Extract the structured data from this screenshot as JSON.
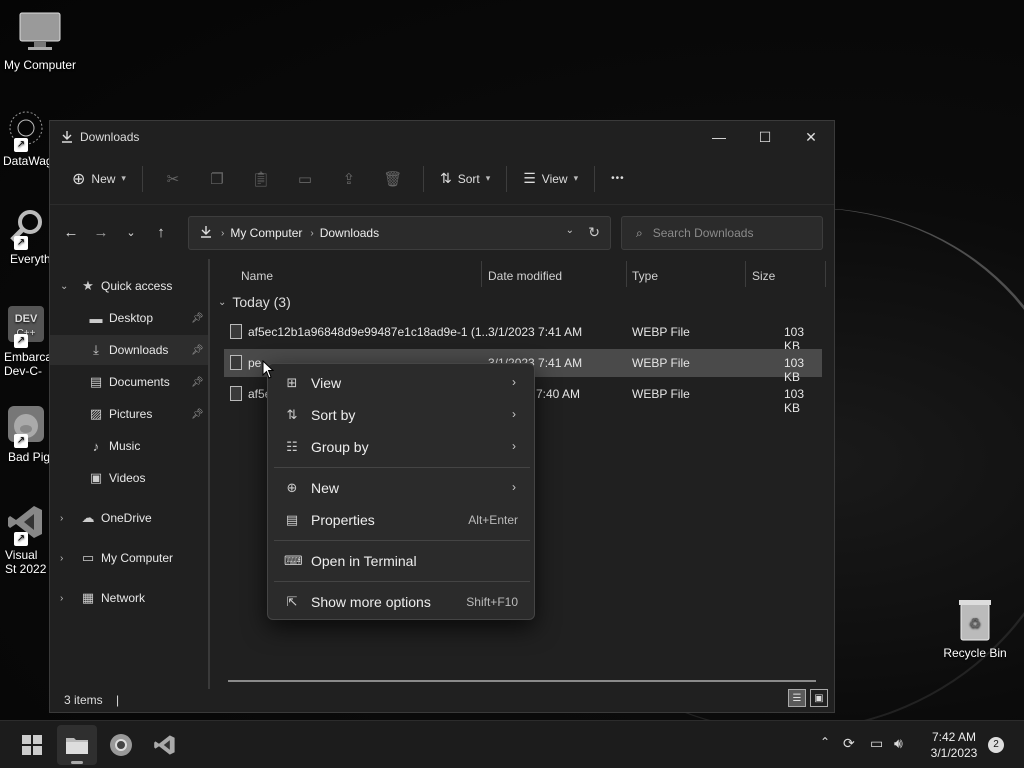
{
  "desktop": {
    "icons": [
      {
        "label": "My Computer"
      },
      {
        "label": "DataWag"
      },
      {
        "label": "Everyth"
      },
      {
        "label": "Embarca Dev-C-"
      },
      {
        "label": "Bad Pig"
      },
      {
        "label": "Visual St 2022"
      },
      {
        "label": "Recycle Bin"
      }
    ]
  },
  "window": {
    "title": "Downloads",
    "controls": {
      "minimize": "—",
      "maximize": "☐",
      "close": "✕"
    }
  },
  "toolbar": {
    "new_label": "New",
    "sort_label": "Sort",
    "view_label": "View",
    "more_label": "•••"
  },
  "address": {
    "crumbs": [
      "My Computer",
      "Downloads"
    ]
  },
  "search": {
    "placeholder": "Search Downloads"
  },
  "sidebar": {
    "items": [
      {
        "label": "Quick access"
      },
      {
        "label": "Desktop"
      },
      {
        "label": "Downloads"
      },
      {
        "label": "Documents"
      },
      {
        "label": "Pictures"
      },
      {
        "label": "Music"
      },
      {
        "label": "Videos"
      },
      {
        "label": "OneDrive"
      },
      {
        "label": "My Computer"
      },
      {
        "label": "Network"
      }
    ]
  },
  "columns": {
    "name": "Name",
    "date": "Date modified",
    "type": "Type",
    "size": "Size"
  },
  "group": {
    "label": "Today (3)"
  },
  "files": [
    {
      "name": "af5ec12b1a96848d9e99487e1c18ad9e-1 (1...",
      "date": "3/1/2023 7:41 AM",
      "type": "WEBP File",
      "size": "103 KB"
    },
    {
      "name": "pe",
      "date": "3/1/2023 7:41 AM",
      "type": "WEBP File",
      "size": "103 KB"
    },
    {
      "name": "af5e",
      "date": "7:40 AM",
      "type": "WEBP File",
      "size": "103 KB"
    }
  ],
  "status": {
    "items": "3 items"
  },
  "context_menu": {
    "view": "View",
    "sort_by": "Sort by",
    "group_by": "Group by",
    "new": "New",
    "properties": "Properties",
    "properties_key": "Alt+Enter",
    "open_terminal": "Open in Terminal",
    "show_more": "Show more options",
    "show_more_key": "Shift+F10"
  },
  "taskbar": {
    "time": "7:42 AM",
    "date": "3/1/2023",
    "notifications": "2"
  }
}
